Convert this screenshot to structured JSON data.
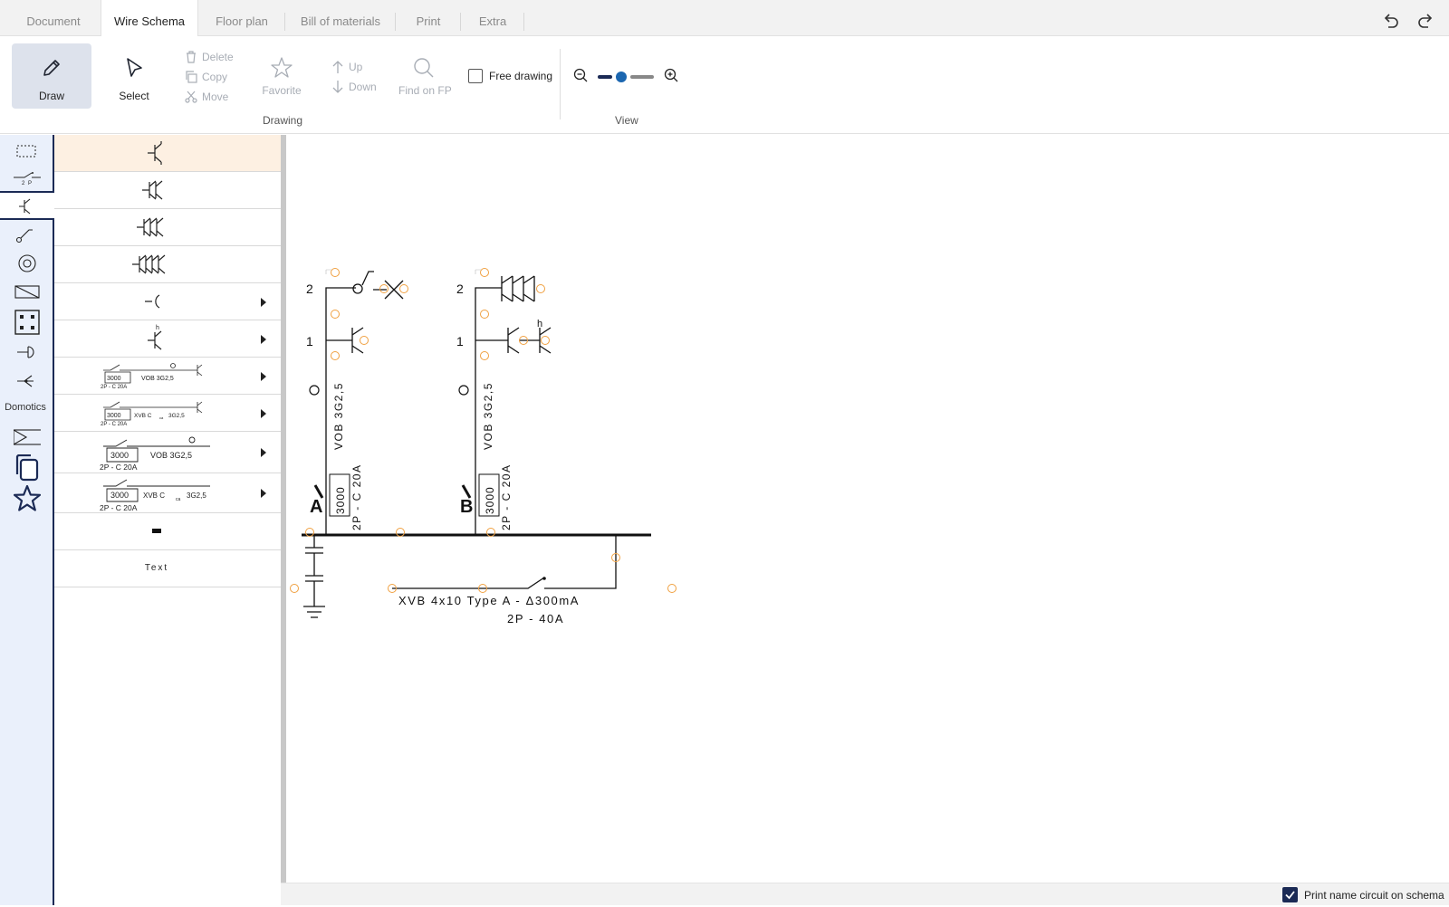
{
  "tabs": [
    {
      "label": "Document"
    },
    {
      "label": "Wire Schema",
      "active": true
    },
    {
      "label": "Floor plan"
    },
    {
      "label": "Bill of materials"
    },
    {
      "label": "Print"
    },
    {
      "label": "Extra"
    }
  ],
  "toolbar_icons": {
    "undo": "undo-icon",
    "redo": "redo-icon"
  },
  "ribbon": {
    "draw_label": "Draw",
    "select_label": "Select",
    "delete_label": "Delete",
    "copy_label": "Copy",
    "move_label": "Move",
    "favorite_label": "Favorite",
    "up_label": "Up",
    "down_label": "Down",
    "find_label": "Find on FP",
    "free_drawing_label": "Free drawing",
    "free_drawing_checked": false,
    "drawing_group": "Drawing",
    "view_group": "View",
    "zoom_level": 0.25
  },
  "rail": {
    "switch_caption": "2 P",
    "domotics_label": "Domotics"
  },
  "symbol_list": {
    "row_captions": {
      "vob": "VOB 3G2,5",
      "xvb": "XVB C",
      "xvb_sub": "ca",
      "xvb_tail": "3G2,5",
      "counter": "3000",
      "breaker": "2P - C 20A",
      "text_item": "Text"
    }
  },
  "schema": {
    "circuit_a": {
      "name": "A",
      "points": [
        "2",
        "1"
      ],
      "cable": "VOB 3G2,5",
      "counter": "3000",
      "breaker": "2P - C 20A"
    },
    "circuit_b": {
      "name": "B",
      "points": [
        "2",
        "1"
      ],
      "cable": "VOB 3G2,5",
      "counter": "3000",
      "breaker": "2P - C 20A",
      "h_label": "h"
    },
    "main_cable": "XVB 4x10 Type A - Δ300mA",
    "main_breaker": "2P - 40A"
  },
  "footer": {
    "print_name_label": "Print name circuit on schema",
    "print_name_checked": true
  },
  "colors": {
    "accent": "#1b2a55",
    "handle": "#f0a040",
    "highlight": "#fdf0e2",
    "rail_bg": "#eaf0fb"
  }
}
